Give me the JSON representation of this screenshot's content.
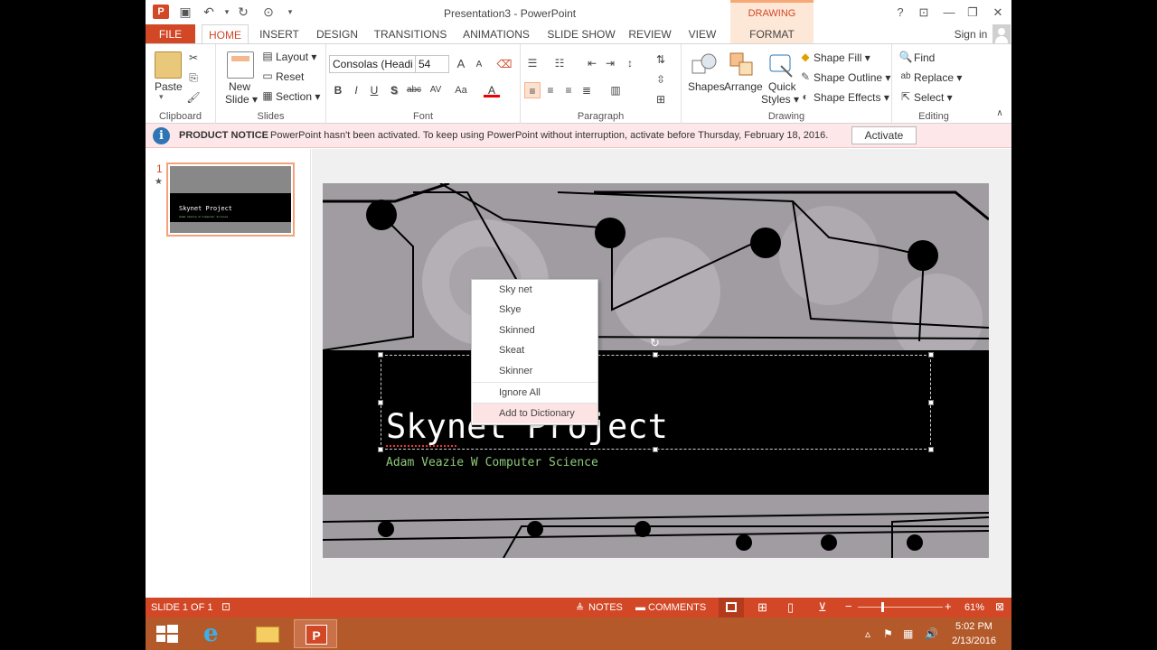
{
  "window": {
    "title": "Presentation3 - PowerPoint",
    "contextual_header": "DRAWING TOOLS",
    "buttons": {
      "help": "?",
      "ribbon_display": "⊡",
      "restore": "❐",
      "close": "✕"
    }
  },
  "qat": {
    "save": "💾",
    "undo": "↶",
    "redo": "↻",
    "present": "⊙",
    "customize": "▾"
  },
  "tabs": [
    "FILE",
    "HOME",
    "INSERT",
    "DESIGN",
    "TRANSITIONS",
    "ANIMATIONS",
    "SLIDE SHOW",
    "REVIEW",
    "VIEW",
    "FORMAT"
  ],
  "signin": "Sign in",
  "ribbon": {
    "clipboard": {
      "label": "Clipboard",
      "paste": "Paste"
    },
    "slides": {
      "label": "Slides",
      "new_slide": "New",
      "new_slide2": "Slide ▾",
      "layout": "Layout ▾",
      "reset": "Reset",
      "section": "Section ▾"
    },
    "font": {
      "label": "Font",
      "font_name": "Consolas (Headi",
      "font_size": "54",
      "bold": "B",
      "italic": "I",
      "underline": "U",
      "shadow": "S",
      "strike": "abc",
      "spacing": "AV",
      "case": "Aa",
      "color": "A",
      "grow": "A",
      "shrink": "A"
    },
    "paragraph": {
      "label": "Paragraph"
    },
    "drawing": {
      "label": "Drawing",
      "shapes": "Shapes",
      "arrange": "Arrange",
      "quick": "Quick",
      "styles": "Styles ▾",
      "fill": "Shape Fill ▾",
      "outline": "Shape Outline ▾",
      "effects": "Shape Effects ▾"
    },
    "editing": {
      "label": "Editing",
      "find": "Find",
      "replace": "Replace ▾",
      "select": "Select ▾"
    }
  },
  "notice": {
    "title": "PRODUCT NOTICE",
    "text": "PowerPoint hasn't been activated. To keep using PowerPoint without interruption, activate before Thursday, February 18, 2016.",
    "button": "Activate"
  },
  "thumbnails": [
    {
      "number": "1",
      "marker": "★",
      "title": "Skynet Project",
      "subtitle": "Adam Veazie W Computer Science"
    }
  ],
  "slide": {
    "title": "Skynet Project",
    "subtitle": "Adam Veazie W Computer Science"
  },
  "context_menu": {
    "suggestions": [
      "Sky net",
      "Skye",
      "Skinned",
      "Skeat",
      "Skinner"
    ],
    "ignore_all": "Ignore All",
    "add_to_dictionary": "Add to Dictionary"
  },
  "status": {
    "slide_count": "SLIDE 1 OF 1",
    "notes": "NOTES",
    "comments": "COMMENTS",
    "zoom": "61%",
    "zoom_level": 0.61
  },
  "taskbar": {
    "time": "5:02 PM",
    "date": "2/13/2016"
  },
  "colors": {
    "accent": "#d24726",
    "notice_bg": "#fde7e9",
    "format_tab": "#fde8d8"
  }
}
